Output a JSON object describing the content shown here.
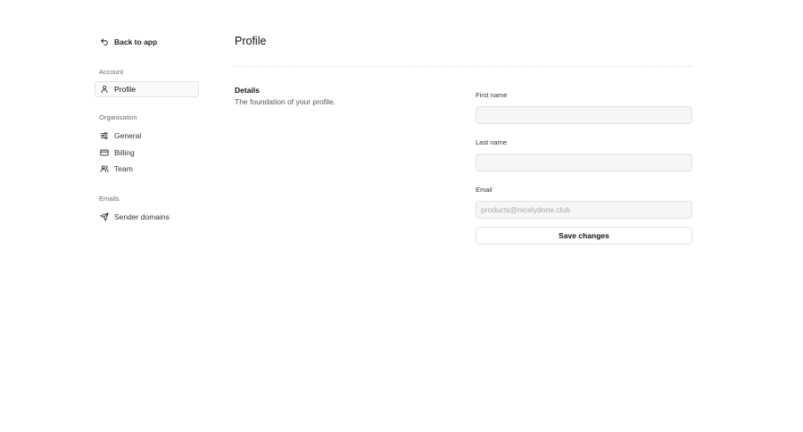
{
  "sidebar": {
    "back_label": "Back to app",
    "sections": {
      "account": {
        "label": "Account",
        "items": [
          {
            "label": "Profile",
            "icon": "user-icon",
            "active": true
          }
        ]
      },
      "organisation": {
        "label": "Organisation",
        "items": [
          {
            "label": "General",
            "icon": "sliders-icon"
          },
          {
            "label": "Billing",
            "icon": "credit-card-icon"
          },
          {
            "label": "Team",
            "icon": "users-icon"
          }
        ]
      },
      "emails": {
        "label": "Emails",
        "items": [
          {
            "label": "Sender domains",
            "icon": "send-icon"
          }
        ]
      }
    }
  },
  "main": {
    "title": "Profile",
    "details": {
      "title": "Details",
      "subtitle": "The foundation of your profile."
    },
    "form": {
      "first_name": {
        "label": "First name",
        "value": "",
        "placeholder": ""
      },
      "last_name": {
        "label": "Last name",
        "value": "",
        "placeholder": ""
      },
      "email": {
        "label": "Email",
        "value": "",
        "placeholder": "products@nicelydone.club"
      },
      "save_label": "Save changes"
    }
  }
}
